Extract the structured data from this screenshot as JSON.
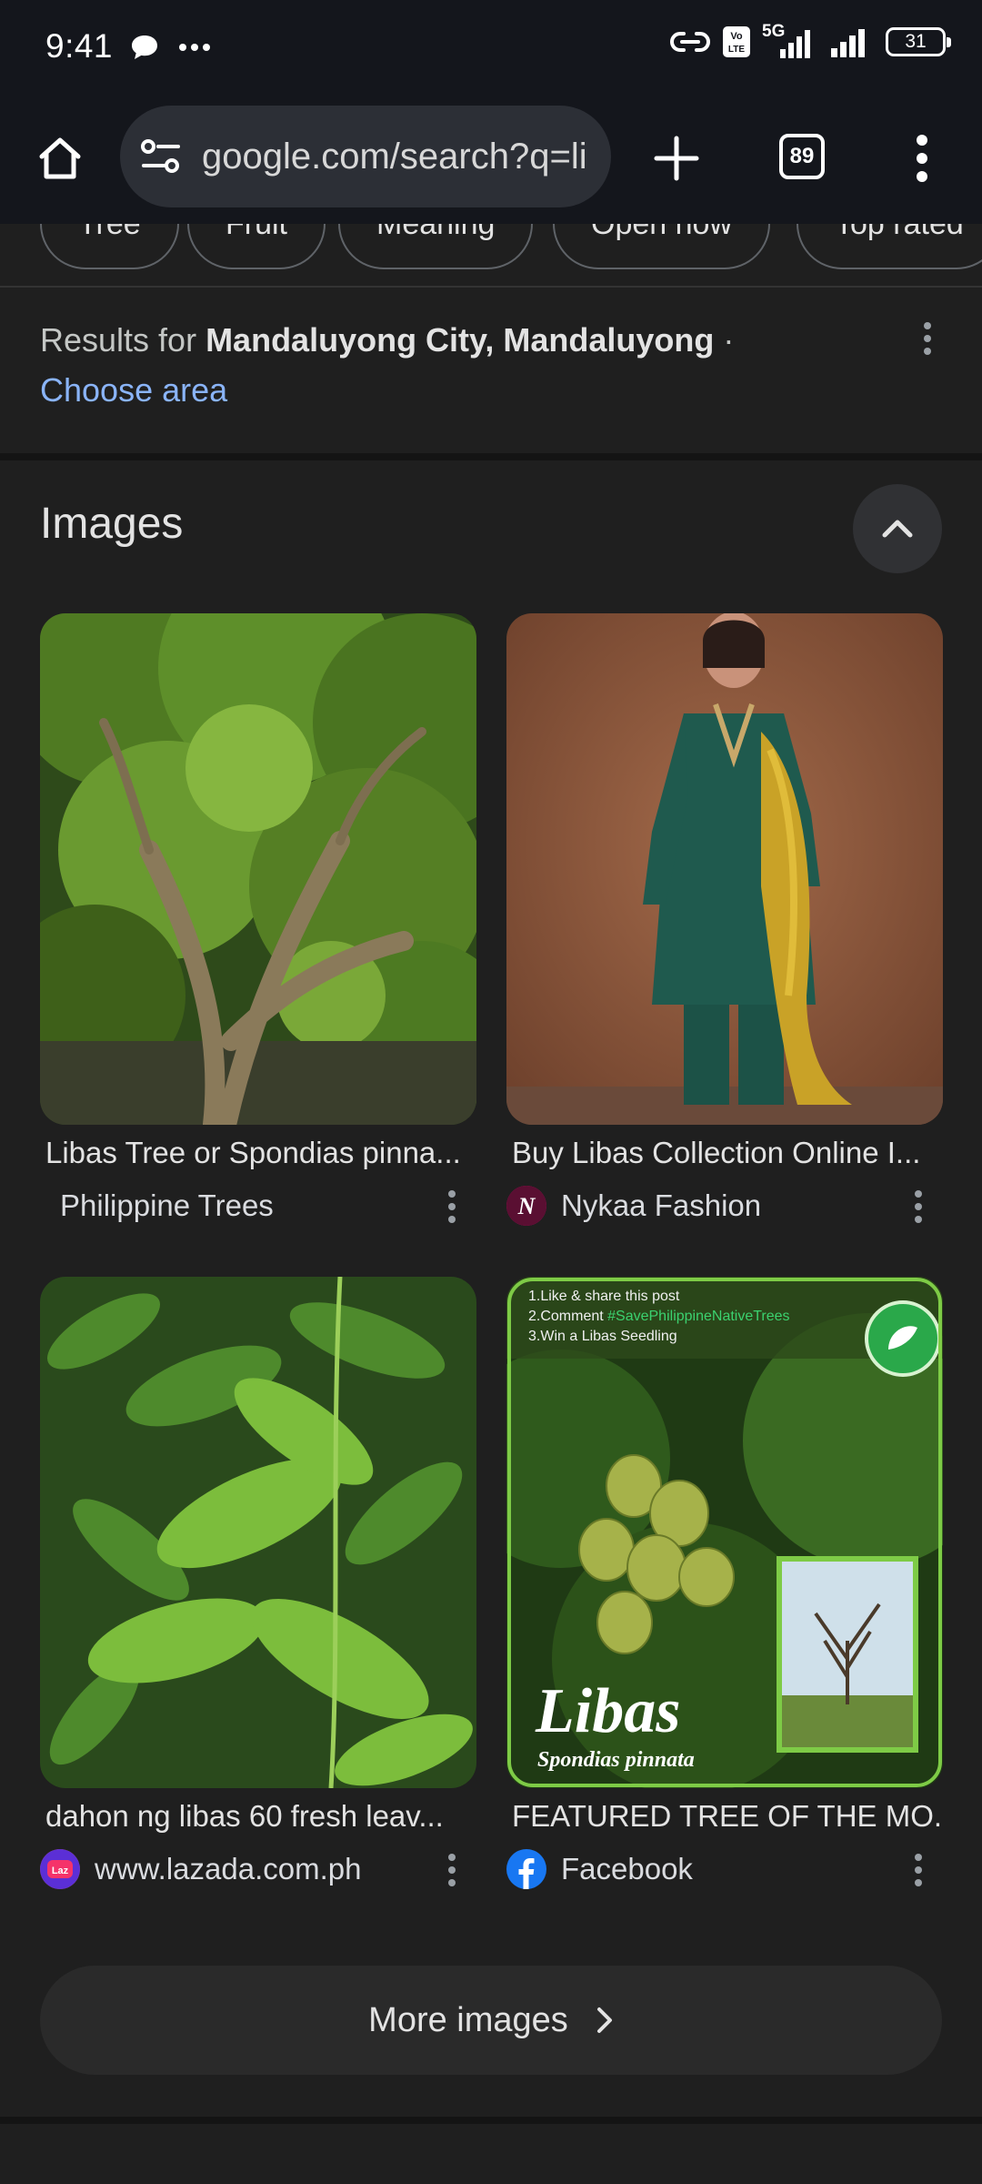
{
  "status_bar": {
    "time": "9:41",
    "network": "5G",
    "volte": "Vo LTE",
    "battery": "31"
  },
  "toolbar": {
    "url": "google.com/search?q=li",
    "tab_count": "89"
  },
  "chips": [
    "Tree",
    "Fruit",
    "Meaning",
    "Open now",
    "Top rated"
  ],
  "results_for": {
    "prefix": "Results for ",
    "location": "Mandaluyong City, Mandaluyong",
    "separator": " ·",
    "choose_area": "Choose area"
  },
  "images_section": {
    "title": "Images",
    "results": [
      {
        "caption": "Libas Tree or Spondias pinna...",
        "source": "Philippine Trees",
        "icon": "none"
      },
      {
        "caption": "Buy Libas Collection Online I...",
        "source": "Nykaa Fashion",
        "icon": "nykaa-logo"
      },
      {
        "caption": "dahon ng libas 60 fresh leav...",
        "source": "www.lazada.com.ph",
        "icon": "lazada-logo"
      },
      {
        "caption": "FEATURED TREE OF THE MO...",
        "source": "Facebook",
        "icon": "facebook-logo"
      }
    ],
    "poster": {
      "line1": "1.Like & share this post",
      "line2_prefix": "2.Comment ",
      "line2_tag": "#SavePhilippineNativeTrees",
      "line3": "3.Win a Libas Seedling",
      "title": "Libas",
      "subtitle": "Spondias pinnata"
    },
    "more_images_label": "More images"
  },
  "colors": {
    "background": "#1f1f1f",
    "link": "#8ab4f8",
    "toolbar": "#14161c"
  }
}
